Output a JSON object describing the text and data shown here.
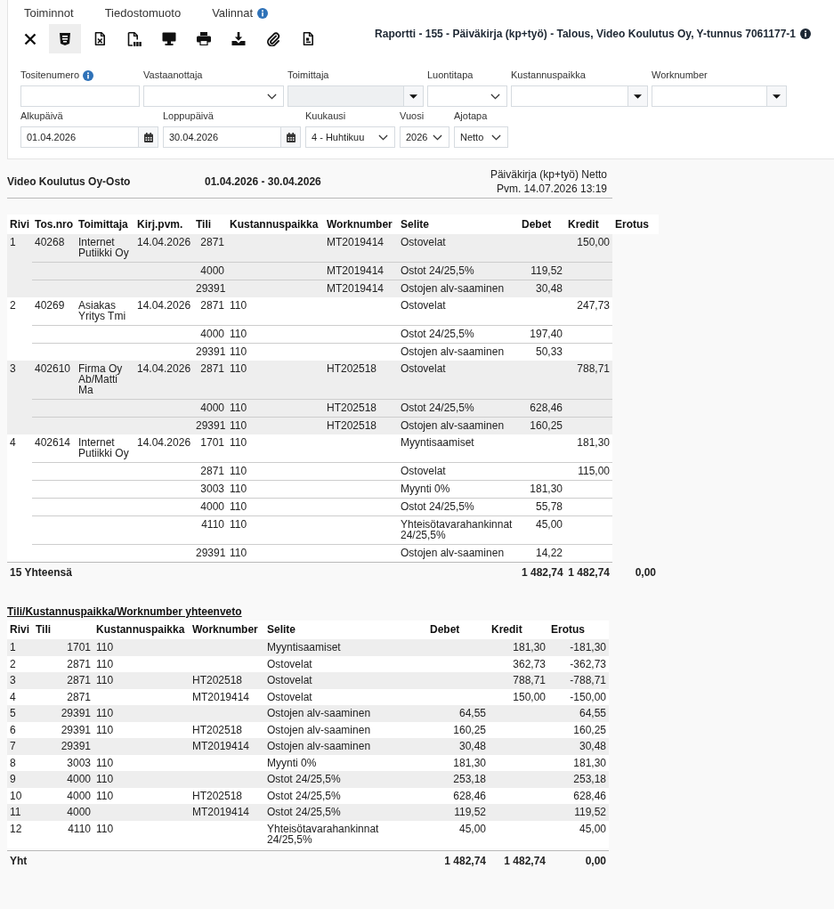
{
  "menu": [
    {
      "label": "Toiminnot",
      "info": false
    },
    {
      "label": "Tiedostomuoto",
      "info": false
    },
    {
      "label": "Valinnat",
      "info": true
    }
  ],
  "toolbar": [
    {
      "kind": "close",
      "selected": false
    },
    {
      "kind": "html",
      "selected": true
    },
    {
      "kind": "excel",
      "selected": false
    },
    {
      "kind": "pdf",
      "selected": false
    },
    {
      "kind": "screen",
      "selected": false
    },
    {
      "kind": "print",
      "selected": false
    },
    {
      "kind": "download",
      "selected": false
    },
    {
      "kind": "attachment",
      "selected": false
    },
    {
      "kind": "document",
      "selected": false
    }
  ],
  "report_title": "Raportti - 155 - Päiväkirja (kp+työ) - Talous, Video Koulutus Oy, Y-tunnus 7061177-1",
  "filters": [
    [
      {
        "label": "Tositenumero",
        "kind": "text",
        "info": true,
        "disabled": false
      },
      {
        "label": "Vastaanottaja",
        "kind": "select",
        "info": false,
        "disabled": false
      },
      {
        "label": "Toimittaja",
        "kind": "combo",
        "info": false,
        "disabled": true
      },
      {
        "label": "Luontitapa",
        "kind": "select",
        "info": false,
        "disabled": false
      },
      {
        "label": "Kustannuspaikka",
        "kind": "combo",
        "info": false,
        "disabled": false
      },
      {
        "label": "Worknumber",
        "kind": "combo",
        "info": false,
        "disabled": false
      }
    ],
    [
      {
        "label": "Alkupäivä",
        "kind": "date",
        "value": "01.04.2026",
        "info": false,
        "disabled": false
      },
      {
        "label": "Loppupäivä",
        "kind": "date",
        "value": "30.04.2026",
        "info": false,
        "disabled": false
      },
      {
        "label": "Kuukausi",
        "kind": "select",
        "value": "4 - Huhtikuu",
        "info": false,
        "disabled": false
      },
      {
        "label": "Vuosi",
        "kind": "select",
        "value": "2026",
        "info": false,
        "disabled": false
      },
      {
        "label": "Ajotapa",
        "kind": "select",
        "value": "Netto",
        "info": false,
        "disabled": false
      }
    ]
  ],
  "report": {
    "company": "Video Koulutus Oy-Osto",
    "period": "01.04.2026 - 30.04.2026",
    "report_type": "Päiväkirja (kp+työ) Netto",
    "printed": "Pvm. 14.07.2026 13:19"
  },
  "journal": {
    "columns": [
      "Rivi",
      "Tos.nro",
      "Toimittaja",
      "Kirj.pvm.",
      "Tili",
      "Kustannuspaikka",
      "Worknumber",
      "Selite",
      "Debet",
      "Kredit",
      "Erotus"
    ],
    "entries": [
      {
        "rivi": "1",
        "tos_nro": "40268",
        "toimittaja": "Internet Putiikki Oy",
        "kirj_pvm": "14.04.2026",
        "lines": [
          {
            "tili": "2871",
            "worknumber": "MT2019414",
            "selite": "Ostovelat",
            "kredit": "150,00"
          },
          {
            "tili": "4000",
            "worknumber": "MT2019414",
            "selite": "Ostot 24/25,5%",
            "debet": "119,52"
          },
          {
            "tili": "29391",
            "worknumber": "MT2019414",
            "selite": "Ostojen alv-saaminen",
            "debet": "30,48"
          }
        ]
      },
      {
        "rivi": "2",
        "tos_nro": "40269",
        "toimittaja": "Asiakas Yritys Tmi",
        "kirj_pvm": "14.04.2026",
        "lines": [
          {
            "tili": "2871",
            "kustannuspaikka": "110",
            "selite": "Ostovelat",
            "kredit": "247,73"
          },
          {
            "tili": "4000",
            "kustannuspaikka": "110",
            "selite": "Ostot 24/25,5%",
            "debet": "197,40"
          },
          {
            "tili": "29391",
            "kustannuspaikka": "110",
            "selite": "Ostojen alv-saaminen",
            "debet": "50,33"
          }
        ]
      },
      {
        "rivi": "3",
        "tos_nro": "402610",
        "toimittaja": "Firma Oy Ab/Matti Ma",
        "kirj_pvm": "14.04.2026",
        "lines": [
          {
            "tili": "2871",
            "kustannuspaikka": "110",
            "worknumber": "HT202518",
            "selite": "Ostovelat",
            "kredit": "788,71"
          },
          {
            "tili": "4000",
            "kustannuspaikka": "110",
            "worknumber": "HT202518",
            "selite": "Ostot 24/25,5%",
            "debet": "628,46"
          },
          {
            "tili": "29391",
            "kustannuspaikka": "110",
            "worknumber": "HT202518",
            "selite": "Ostojen alv-saaminen",
            "debet": "160,25"
          }
        ]
      },
      {
        "rivi": "4",
        "tos_nro": "402614",
        "toimittaja": "Internet Putiikki Oy",
        "kirj_pvm": "14.04.2026",
        "lines": [
          {
            "tili": "1701",
            "kustannuspaikka": "110",
            "selite": "Myyntisaamiset",
            "kredit": "181,30"
          },
          {
            "tili": "2871",
            "kustannuspaikka": "110",
            "selite": "Ostovelat",
            "kredit": "115,00"
          },
          {
            "tili": "3003",
            "kustannuspaikka": "110",
            "selite": "Myynti 0%",
            "debet": "181,30"
          },
          {
            "tili": "4000",
            "kustannuspaikka": "110",
            "selite": "Ostot 24/25,5%",
            "debet": "55,78"
          },
          {
            "tili": "4110",
            "kustannuspaikka": "110",
            "selite": "Yhteisötavarahankinnat 24/25,5%",
            "debet": "45,00"
          },
          {
            "tili": "29391",
            "kustannuspaikka": "110",
            "selite": "Ostojen alv-saaminen",
            "debet": "14,22"
          }
        ]
      }
    ],
    "total": {
      "label": "15 Yhteensä",
      "debet": "1 482,74",
      "kredit": "1 482,74",
      "erotus": "0,00"
    }
  },
  "summary": {
    "title": "Tili/Kustannuspaikka/Worknumber yhteenveto",
    "columns": [
      "Rivi",
      "Tili",
      "Kustannuspaikka",
      "Worknumber",
      "Selite",
      "Debet",
      "Kredit",
      "Erotus"
    ],
    "rows": [
      {
        "rivi": "1",
        "tili": "1701",
        "kustannuspaikka": "110",
        "selite": "Myyntisaamiset",
        "kredit": "181,30",
        "erotus": "-181,30"
      },
      {
        "rivi": "2",
        "tili": "2871",
        "kustannuspaikka": "110",
        "selite": "Ostovelat",
        "kredit": "362,73",
        "erotus": "-362,73"
      },
      {
        "rivi": "3",
        "tili": "2871",
        "kustannuspaikka": "110",
        "worknumber": "HT202518",
        "selite": "Ostovelat",
        "kredit": "788,71",
        "erotus": "-788,71"
      },
      {
        "rivi": "4",
        "tili": "2871",
        "worknumber": "MT2019414",
        "selite": "Ostovelat",
        "kredit": "150,00",
        "erotus": "-150,00"
      },
      {
        "rivi": "5",
        "tili": "29391",
        "kustannuspaikka": "110",
        "selite": "Ostojen alv-saaminen",
        "debet": "64,55",
        "erotus": "64,55"
      },
      {
        "rivi": "6",
        "tili": "29391",
        "kustannuspaikka": "110",
        "worknumber": "HT202518",
        "selite": "Ostojen alv-saaminen",
        "debet": "160,25",
        "erotus": "160,25"
      },
      {
        "rivi": "7",
        "tili": "29391",
        "worknumber": "MT2019414",
        "selite": "Ostojen alv-saaminen",
        "debet": "30,48",
        "erotus": "30,48"
      },
      {
        "rivi": "8",
        "tili": "3003",
        "kustannuspaikka": "110",
        "selite": "Myynti 0%",
        "debet": "181,30",
        "erotus": "181,30"
      },
      {
        "rivi": "9",
        "tili": "4000",
        "kustannuspaikka": "110",
        "selite": "Ostot 24/25,5%",
        "debet": "253,18",
        "erotus": "253,18"
      },
      {
        "rivi": "10",
        "tili": "4000",
        "kustannuspaikka": "110",
        "worknumber": "HT202518",
        "selite": "Ostot 24/25,5%",
        "debet": "628,46",
        "erotus": "628,46"
      },
      {
        "rivi": "11",
        "tili": "4000",
        "worknumber": "MT2019414",
        "selite": "Ostot 24/25,5%",
        "debet": "119,52",
        "erotus": "119,52"
      },
      {
        "rivi": "12",
        "tili": "4110",
        "kustannuspaikka": "110",
        "selite": "Yhteisötavarahankinnat 24/25,5%",
        "debet": "45,00",
        "erotus": "45,00"
      }
    ],
    "total": {
      "label": "Yht",
      "debet": "1 482,74",
      "kredit": "1 482,74",
      "erotus": "0,00"
    }
  }
}
